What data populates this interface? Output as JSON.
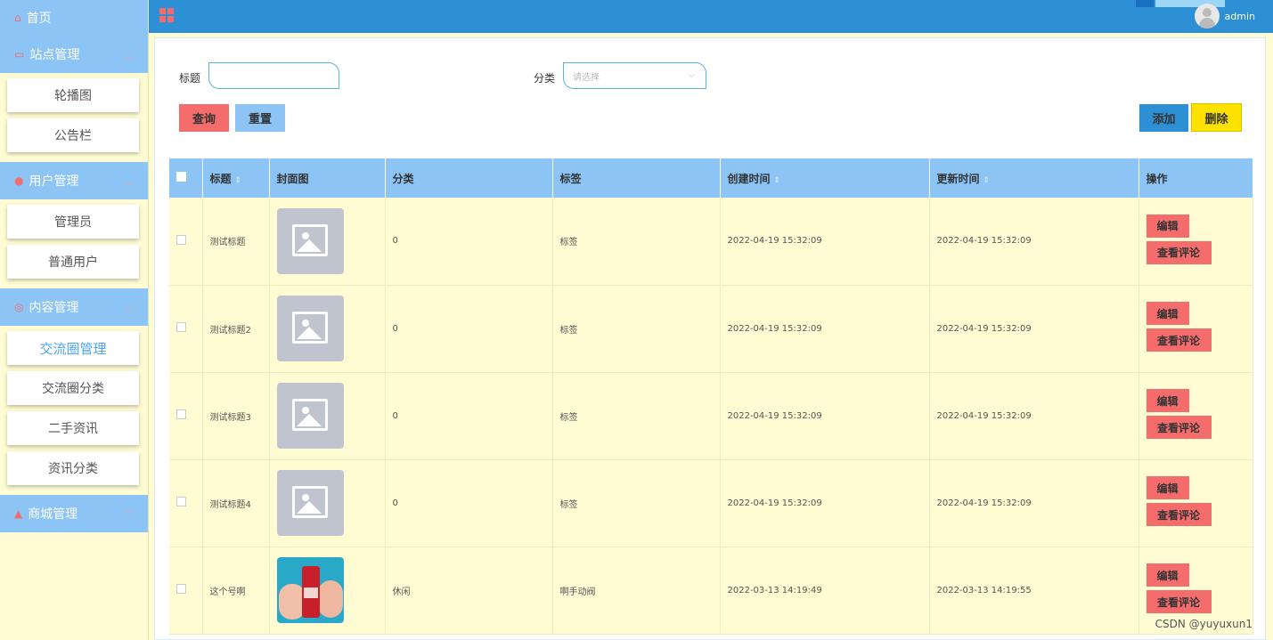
{
  "sidebar": {
    "home": "首页",
    "groups": [
      {
        "label": "站点管理",
        "items": [
          "轮播图",
          "公告栏"
        ]
      },
      {
        "label": "用户管理",
        "items": [
          "管理员",
          "普通用户"
        ]
      },
      {
        "label": "内容管理",
        "items": [
          "交流圈管理",
          "交流圈分类",
          "二手资讯",
          "资讯分类"
        ]
      },
      {
        "label": "商城管理",
        "items": []
      }
    ]
  },
  "header": {
    "user": "admin"
  },
  "search": {
    "title_label": "标题",
    "title_value": "",
    "category_label": "分类",
    "category_placeholder": "请选择",
    "query_button": "查询",
    "reset_button": "重置",
    "add_button": "添加",
    "delete_button": "删除"
  },
  "table": {
    "headers": {
      "title": "标题",
      "cover": "封面图",
      "category": "分类",
      "tag": "标签",
      "created": "创建时间",
      "updated": "更新时间",
      "ops": "操作"
    },
    "edit_label": "编辑",
    "comments_label": "查看评论",
    "rows": [
      {
        "title": "测试标题",
        "category": "0",
        "tag": "标签",
        "created": "2022-04-19 15:32:09",
        "updated": "2022-04-19 15:32:09",
        "cover": "placeholder"
      },
      {
        "title": "测试标题2",
        "category": "0",
        "tag": "标签",
        "created": "2022-04-19 15:32:09",
        "updated": "2022-04-19 15:32:09",
        "cover": "placeholder"
      },
      {
        "title": "测试标题3",
        "category": "0",
        "tag": "标签",
        "created": "2022-04-19 15:32:09",
        "updated": "2022-04-19 15:32:09",
        "cover": "placeholder"
      },
      {
        "title": "测试标题4",
        "category": "0",
        "tag": "标签",
        "created": "2022-04-19 15:32:09",
        "updated": "2022-04-19 15:32:09",
        "cover": "placeholder"
      },
      {
        "title": "这个号啊",
        "category": "休闲",
        "tag": "啊手动阀",
        "created": "2022-03-13 14:19:49",
        "updated": "2022-03-13 14:19:55",
        "cover": "photo"
      }
    ]
  },
  "watermark": "CSDN @yuyuxun1",
  "colors": {
    "sidebar": "#8cc4f5",
    "header": "#2e90d4",
    "danger": "#f56c6c",
    "add": "#2e90d4",
    "delete": "#ffe100",
    "row_bg": "#fffbd2"
  }
}
